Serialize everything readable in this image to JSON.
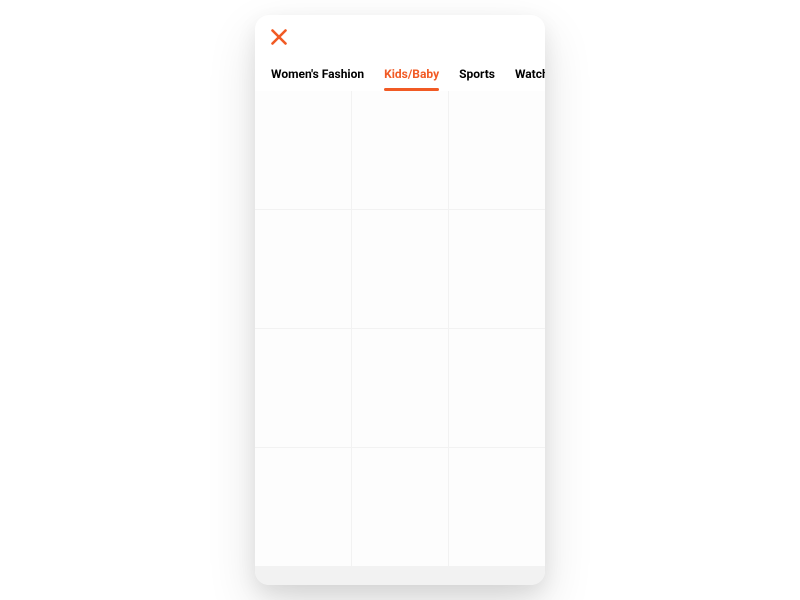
{
  "colors": {
    "accent": "#f15a24"
  },
  "tabs": [
    {
      "label": "Women's Fashion",
      "active": false
    },
    {
      "label": "Kids/Baby",
      "active": true
    },
    {
      "label": "Sports",
      "active": false
    },
    {
      "label": "Watch",
      "active": false
    }
  ]
}
